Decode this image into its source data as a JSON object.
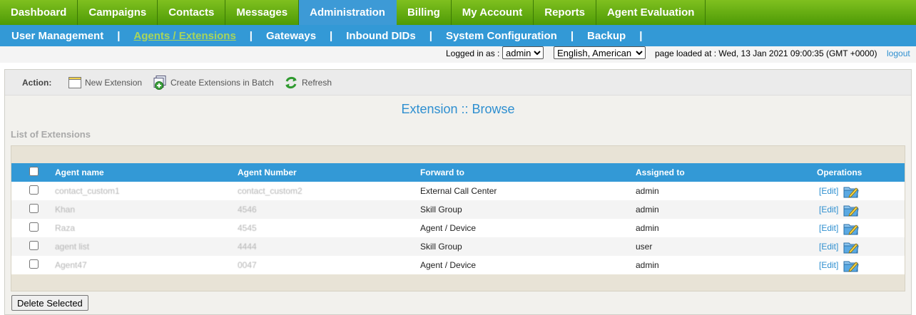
{
  "top_nav": {
    "tabs": [
      "Dashboard",
      "Campaigns",
      "Contacts",
      "Messages",
      "Administration",
      "Billing",
      "My Account",
      "Reports",
      "Agent Evaluation"
    ],
    "active": "Administration"
  },
  "sub_nav": {
    "items": [
      "User Management",
      "Agents / Extensions",
      "Gateways",
      "Inbound DIDs",
      "System Configuration",
      "Backup"
    ],
    "active": "Agents / Extensions"
  },
  "status_bar": {
    "logged_in_label": "Logged in as :",
    "user": "admin",
    "language": "English, American",
    "page_loaded": "page loaded at : Wed, 13 Jan 2021 09:00:35 (GMT +0000)",
    "logout": "logout"
  },
  "action_bar": {
    "label": "Action:",
    "new_extension": "New Extension",
    "create_batch": "Create Extensions in Batch",
    "refresh": "Refresh"
  },
  "page_title": "Extension :: Browse",
  "list_label": "List of Extensions",
  "table": {
    "columns": [
      "Agent name",
      "Agent Number",
      "Forward to",
      "Assigned to",
      "Operations"
    ],
    "rows": [
      {
        "agent_name": "contact_custom1",
        "agent_number": "contact_custom2",
        "forward_to": "External Call Center",
        "assigned_to": "admin",
        "edit": "[Edit]"
      },
      {
        "agent_name": "Khan",
        "agent_number": "4546",
        "forward_to": "Skill Group",
        "assigned_to": "admin",
        "edit": "[Edit]"
      },
      {
        "agent_name": "Raza",
        "agent_number": "4545",
        "forward_to": "Agent / Device",
        "assigned_to": "admin",
        "edit": "[Edit]"
      },
      {
        "agent_name": "agent list",
        "agent_number": "4444",
        "forward_to": "Skill Group",
        "assigned_to": "user",
        "edit": "[Edit]"
      },
      {
        "agent_name": "Agent47",
        "agent_number": "0047",
        "forward_to": "Agent / Device",
        "assigned_to": "admin",
        "edit": "[Edit]"
      }
    ]
  },
  "delete_button": "Delete Selected",
  "colors": {
    "top_nav_green": "#5fa80e",
    "accent_blue": "#3399d6",
    "link_blue": "#2e8fd0",
    "active_sub_green": "#a9d55b"
  }
}
